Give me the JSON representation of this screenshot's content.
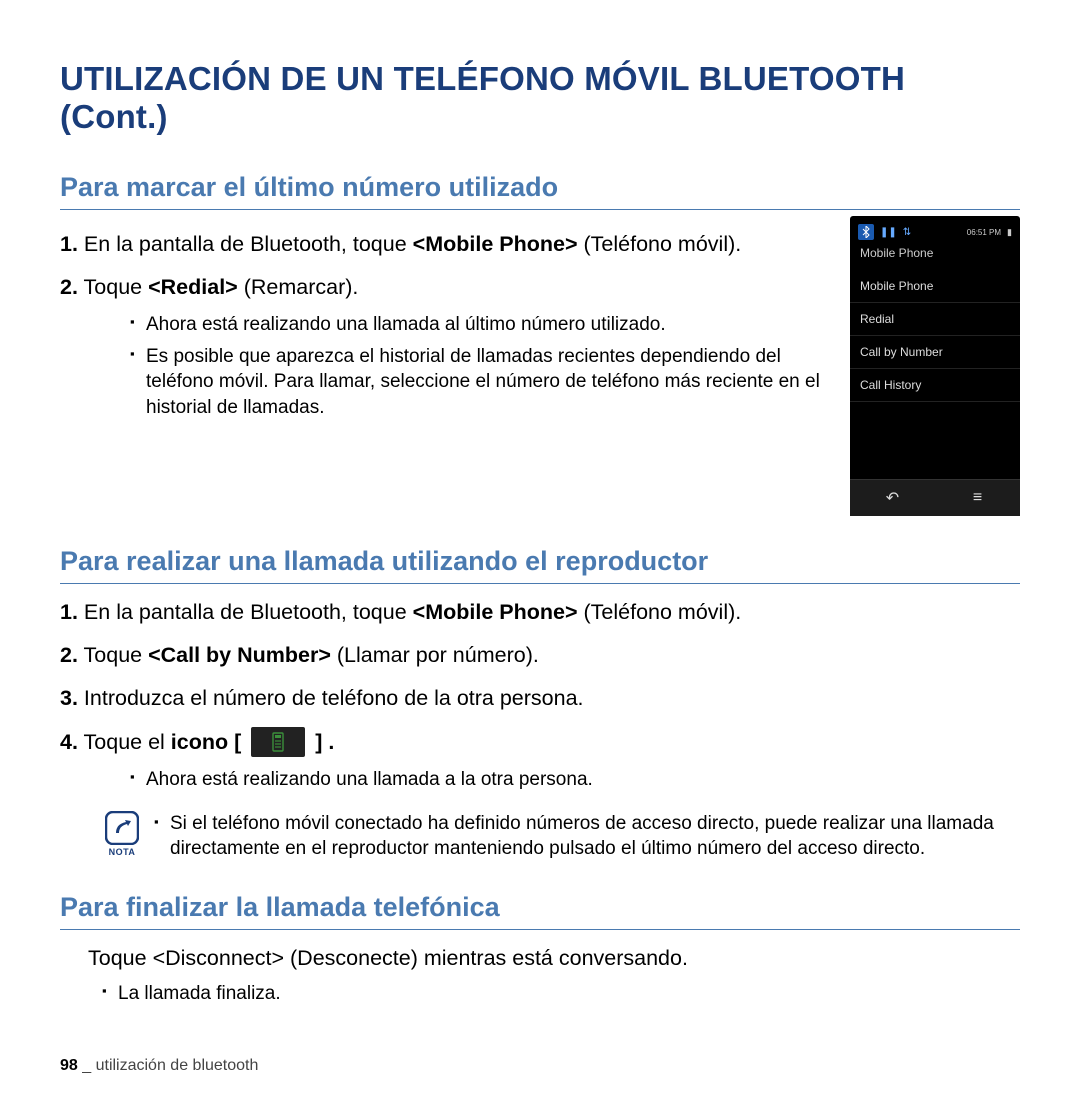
{
  "title": "UTILIZACIÓN DE UN TELÉFONO MÓVIL BLUETOOTH (Cont.)",
  "s1": {
    "heading": "Para marcar el último número utilizado",
    "step1_text": "En la pantalla de Bluetooth, toque ",
    "step1_bold": "<Mobile Phone>",
    "step1_tail": " (Teléfono móvil).",
    "step2_pre": "Toque ",
    "step2_bold": "<Redial>",
    "step2_tail": " (Remarcar).",
    "sub1": "Ahora está realizando una llamada al último número utilizado.",
    "sub2": "Es posible que aparezca el historial de llamadas recientes dependiendo del teléfono móvil. Para llamar, seleccione el número de teléfono más reciente en el historial de llamadas."
  },
  "phone": {
    "time": "06:51 PM",
    "title": "Mobile Phone",
    "items": [
      "Mobile Phone",
      "Redial",
      "Call by Number",
      "Call History"
    ]
  },
  "s2": {
    "heading": "Para realizar una llamada utilizando el reproductor",
    "step1_text": "En la pantalla de Bluetooth, toque ",
    "step1_bold": "<Mobile Phone>",
    "step1_tail": " (Teléfono móvil).",
    "step2_pre": "Toque ",
    "step2_bold": "<Call by Number>",
    "step2_tail": " (Llamar por número).",
    "step3": "Introduzca el número de teléfono de la otra persona.",
    "step4_pre": "Toque el ",
    "step4_bold": "icono [",
    "step4_tail": "] .",
    "sub1": "Ahora está realizando una llamada a la otra persona.",
    "note_label": "NOTA",
    "note_text": "Si el teléfono móvil conectado ha definido números de acceso directo, puede realizar una llamada directamente en el reproductor manteniendo pulsado el último número del acceso directo."
  },
  "s3": {
    "heading": "Para finalizar la llamada telefónica",
    "line_pre": "Toque ",
    "line_bold": "<Disconnect>",
    "line_tail": " (Desconecte) mientras está conversando.",
    "sub1": "La llamada finaliza."
  },
  "footer": {
    "page": "98",
    "sep": " _ ",
    "text": "utilización de bluetooth"
  },
  "numbers": {
    "n1": "1.",
    "n2": "2.",
    "n3": "3.",
    "n4": "4."
  }
}
